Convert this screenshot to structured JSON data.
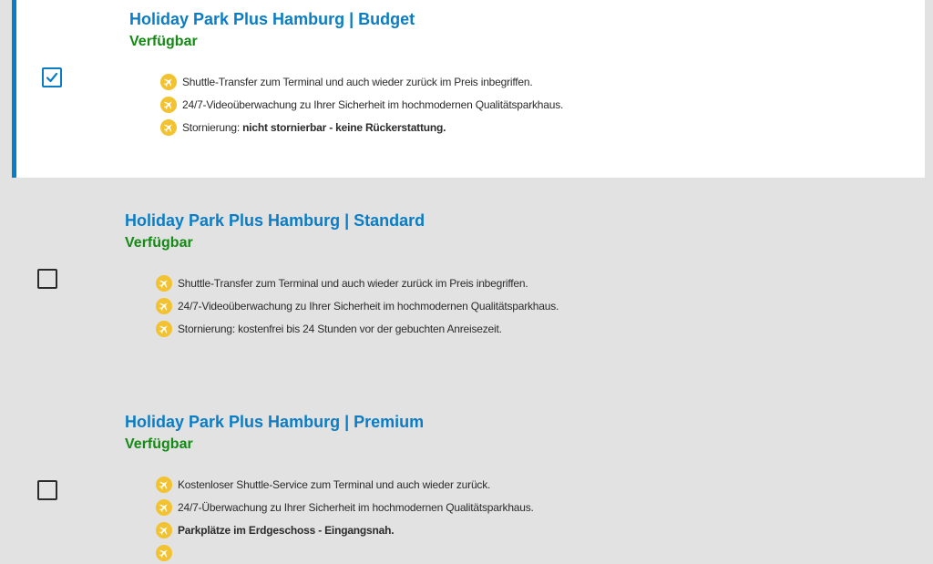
{
  "options": [
    {
      "title": "Holiday Park Plus Hamburg | Budget",
      "status": "Verfügbar",
      "selected": true,
      "features": [
        {
          "text": "Shuttle-Transfer zum Terminal und auch wieder zurück im Preis inbegriffen."
        },
        {
          "text": "24/7-Videoüberwachung zu Ihrer Sicherheit im hochmodernen Qualitätsparkhaus."
        },
        {
          "prefix": "Stornierung: ",
          "bold": "nicht stornierbar - keine Rückerstattung."
        }
      ]
    },
    {
      "title": "Holiday Park Plus Hamburg | Standard",
      "status": "Verfügbar",
      "selected": false,
      "features": [
        {
          "text": "Shuttle-Transfer zum Terminal und auch wieder zurück im Preis inbegriffen."
        },
        {
          "text": "24/7-Videoüberwachung zu Ihrer Sicherheit im hochmodernen Qualitätsparkhaus."
        },
        {
          "text": "Stornierung: kostenfrei bis 24 Stunden vor der gebuchten Anreisezeit."
        }
      ]
    },
    {
      "title": "Holiday Park Plus Hamburg | Premium",
      "status": "Verfügbar",
      "selected": false,
      "features": [
        {
          "text": "Kostenloser Shuttle-Service zum Terminal und auch wieder zurück."
        },
        {
          "text": "24/7-Überwachung zu Ihrer Sicherheit im hochmodernen Qualitätsparkhaus."
        },
        {
          "bold": "Parkplätze im Erdgeschoss - Eingangsnah."
        }
      ]
    }
  ],
  "colors": {
    "accent": "#0b7dc5",
    "available": "#138a13",
    "feature_icon": "#f3c230",
    "selected_bg": "#ffffff",
    "page_bg": "#e2e2e2"
  },
  "icons": {
    "feature": "airplane-icon",
    "checked": "checkmark-icon"
  }
}
